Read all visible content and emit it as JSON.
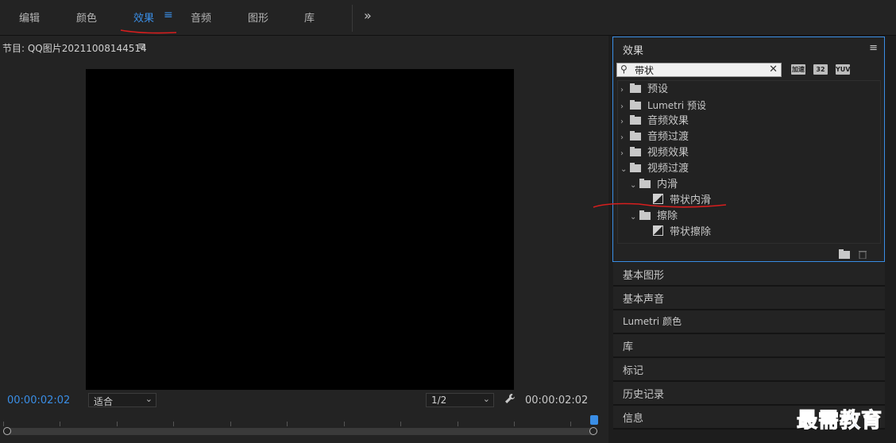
{
  "top_tabs": [
    {
      "label": "编辑"
    },
    {
      "label": "颜色"
    },
    {
      "label": "效果"
    },
    {
      "label": "音频"
    },
    {
      "label": "图形"
    },
    {
      "label": "库"
    }
  ],
  "top_more": "»",
  "active_tab_menu": "≡",
  "monitor": {
    "title": "节目: QQ图片20211008144514",
    "menu_icon": "≡",
    "timecode_current": "00:00:02:02",
    "timecode_total": "00:00:02:02",
    "fit_select": "适合",
    "resolution_select": "1/2",
    "wrench_icon": "wrench-icon"
  },
  "effects_panel": {
    "title": "效果",
    "menu_icon": "≡",
    "search_value": "带状",
    "filter_icons": [
      "加速",
      "32",
      "YUV"
    ],
    "tree": [
      {
        "label": "预设",
        "indent": 0,
        "expanded": false,
        "kind": "preset"
      },
      {
        "label": "Lumetri 预设",
        "indent": 0,
        "expanded": false,
        "kind": "preset"
      },
      {
        "label": "音频效果",
        "indent": 0,
        "expanded": false,
        "kind": "folder"
      },
      {
        "label": "音频过渡",
        "indent": 0,
        "expanded": false,
        "kind": "folder"
      },
      {
        "label": "视频效果",
        "indent": 0,
        "expanded": false,
        "kind": "folder"
      },
      {
        "label": "视频过渡",
        "indent": 0,
        "expanded": true,
        "kind": "folder"
      },
      {
        "label": "内滑",
        "indent": 1,
        "expanded": true,
        "kind": "folder"
      },
      {
        "label": "带状内滑",
        "indent": 2,
        "kind": "effect"
      },
      {
        "label": "擦除",
        "indent": 1,
        "expanded": true,
        "kind": "folder"
      },
      {
        "label": "带状擦除",
        "indent": 2,
        "kind": "effect"
      }
    ]
  },
  "sections": [
    {
      "label": "基本图形"
    },
    {
      "label": "基本声音"
    },
    {
      "label": "Lumetri 颜色"
    },
    {
      "label": "库"
    },
    {
      "label": "标记"
    },
    {
      "label": "历史记录"
    },
    {
      "label": "信息"
    }
  ],
  "watermark": "最需教育",
  "colors": {
    "accent": "#3a8ee6",
    "annotation": "#d81e1e"
  }
}
